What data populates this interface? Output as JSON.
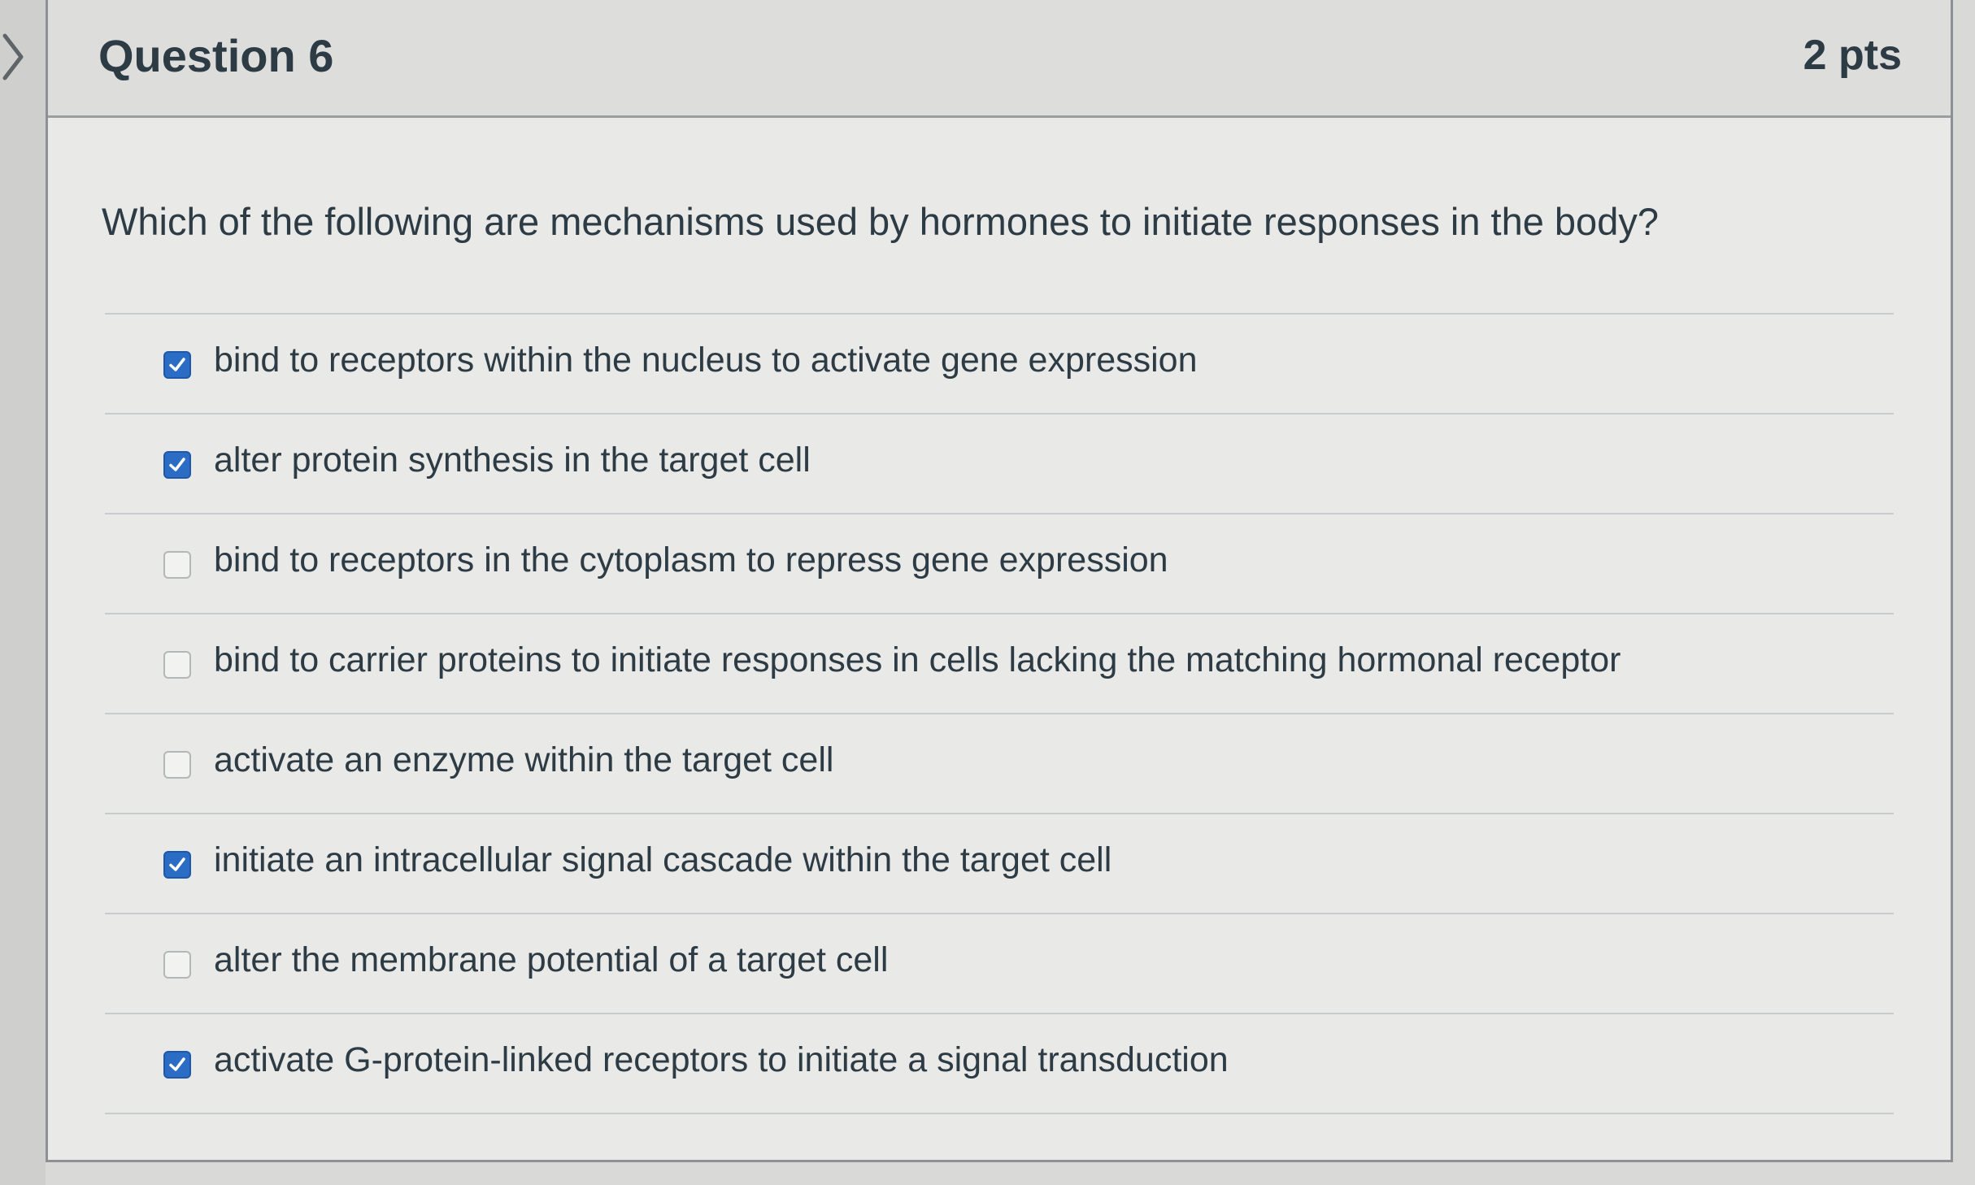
{
  "question": {
    "title": "Question 6",
    "points": "2 pts",
    "prompt": "Which of the following are mechanisms used by hormones to initiate responses in the body?"
  },
  "answers": [
    {
      "label": "bind to receptors within the nucleus to activate gene expression",
      "checked": true
    },
    {
      "label": "alter protein synthesis in the target cell",
      "checked": true
    },
    {
      "label": "bind to receptors in the cytoplasm to repress gene expression",
      "checked": false
    },
    {
      "label": "bind to carrier proteins to initiate responses in cells lacking the matching hormonal receptor",
      "checked": false
    },
    {
      "label": "activate an enzyme within the target cell",
      "checked": false
    },
    {
      "label": "initiate an intracellular signal cascade within the target cell",
      "checked": true
    },
    {
      "label": "alter the membrane potential of a target cell",
      "checked": false
    },
    {
      "label": "activate G-protein-linked receptors to initiate a signal transduction",
      "checked": true
    }
  ],
  "icons": {
    "expand": "chevron-right-icon",
    "checked": "checkmark-icon"
  },
  "colors": {
    "checkbox_checked": "#2b6cc4",
    "text": "#2d3b45",
    "header_bg": "#dddddc",
    "card_bg": "#e9e9e7"
  }
}
